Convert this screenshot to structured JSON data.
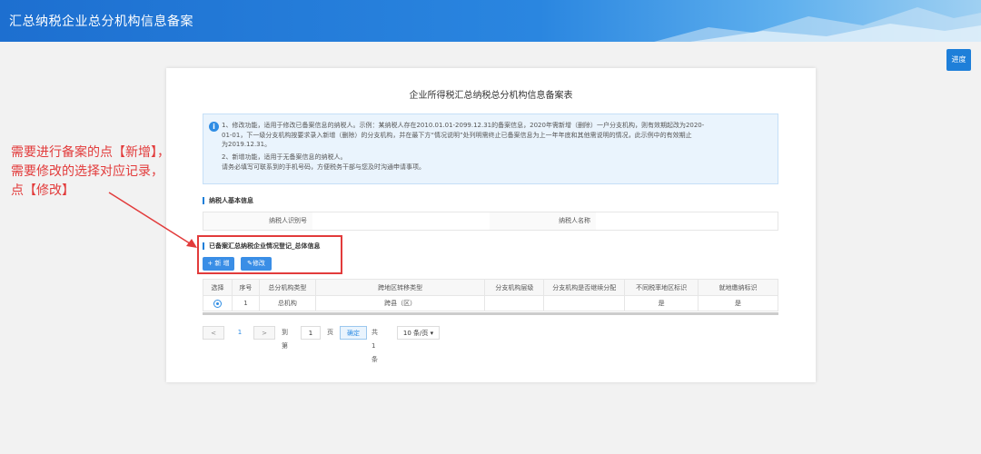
{
  "app": {
    "title": "汇总纳税企业总分机构信息备案"
  },
  "toolbar": {
    "progress_label": "进度"
  },
  "form": {
    "title": "企业所得税汇总纳税总分机构信息备案表",
    "notice": {
      "line1": "1、修改功能，适用于修改已备案信息的纳税人。示例：某纳税人存在2010.01.01-2099.12.31的备案信息，2020年需新增（删除）一户分支机构，则有效期起改为2020-",
      "line2": "01-01，下一级分支机构按要求录入新增（删除）的分支机构，并在最下方“情况说明”处列明需终止已备案信息为上一年年底和其他需说明的情况，此示例中的有效期止",
      "line3": "为2019.12.31。",
      "line4": "2、新增功能，适用于无备案信息的纳税人。",
      "line5": "请务必填写可联系到的手机号码，方便税务干部与您及时沟通申请事项。"
    },
    "basic_section": "纳税人基本信息",
    "taxpayer_id_label": "纳税人识别号",
    "taxpayer_name_label": "纳税人名称",
    "filed_section": "已备案汇总纳税企业情况登记_总体信息",
    "add_button": "+ 新 增",
    "edit_button": "修改",
    "table": {
      "headers": [
        "选择",
        "序号",
        "总分机构类型",
        "跨地区转移类型",
        "分支机构层级",
        "分支机构是否继续分配",
        "不同税率地区标识",
        "就地缴纳标识"
      ],
      "rows": [
        {
          "seq": "1",
          "org_type": "总机构",
          "transfer_type": "跨县（区）",
          "level": "",
          "continue_alloc": "",
          "diff_rate": "是",
          "local_pay": "是"
        }
      ]
    },
    "pager": {
      "prev": "<",
      "page": "1",
      "next": ">",
      "goto_label": "到第",
      "goto_value": "1",
      "page_unit": "页",
      "confirm": "确定",
      "total": "共 1 条",
      "page_size": "10 条/页"
    }
  },
  "annotation": {
    "line1": "需要进行备案的点【新增】，",
    "line2": "需要修改的选择对应记录，",
    "line3": "点【修改】"
  },
  "colors": {
    "accent": "#1e7fd9",
    "annotation": "#e23b3b"
  }
}
